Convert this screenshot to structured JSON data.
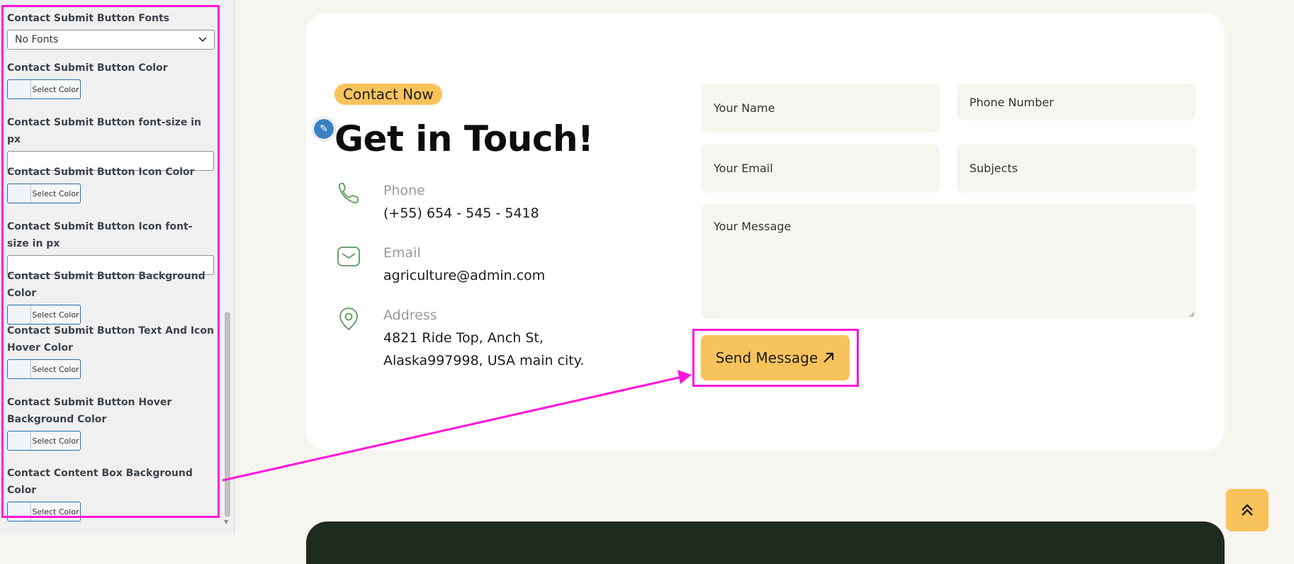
{
  "panel": {
    "fields": [
      {
        "label": "Contact Submit Button Fonts",
        "type": "select",
        "value": "No Fonts"
      },
      {
        "label": "Contact Submit Button Color",
        "type": "color",
        "button": "Select Color"
      },
      {
        "label": "Contact Submit Button font-size in px",
        "type": "text",
        "value": ""
      },
      {
        "label": "Contact Submit Button Icon Color",
        "type": "color",
        "button": "Select Color"
      },
      {
        "label": "Contact Submit Button Icon font-size in px",
        "type": "text",
        "value": ""
      },
      {
        "label": "Contact Submit Button Background Color",
        "type": "color",
        "button": "Select Color"
      },
      {
        "label": "Contact Submit Button Text And Icon Hover Color",
        "type": "color",
        "button": "Select Color"
      },
      {
        "label": "Contact Submit Button Hover Background Color",
        "type": "color",
        "button": "Select Color"
      },
      {
        "label": "Contact Content Box Background Color",
        "type": "color",
        "button": "Select Color"
      }
    ]
  },
  "contact": {
    "tag": "Contact Now",
    "title": "Get in Touch!",
    "phone": {
      "label": "Phone",
      "value": "(+55) 654 - 545 - 5418"
    },
    "email": {
      "label": "Email",
      "value": "agriculture@admin.com"
    },
    "address": {
      "label": "Address",
      "line1": "4821 Ride Top, Anch St,",
      "line2": "Alaska997998, USA main city."
    }
  },
  "form": {
    "name_placeholder": "Your Name",
    "phone_placeholder": "Phone Number",
    "email_placeholder": "Your Email",
    "subject_placeholder": "Subjects",
    "message_placeholder": "Your Message",
    "submit_label": "Send Message"
  },
  "colors": {
    "highlight": "#ff16d9",
    "accent": "#f8c35a",
    "icon_green": "#5a9a5e",
    "dark_band": "#1e2b1f",
    "edit_blue": "#3b82c4"
  }
}
